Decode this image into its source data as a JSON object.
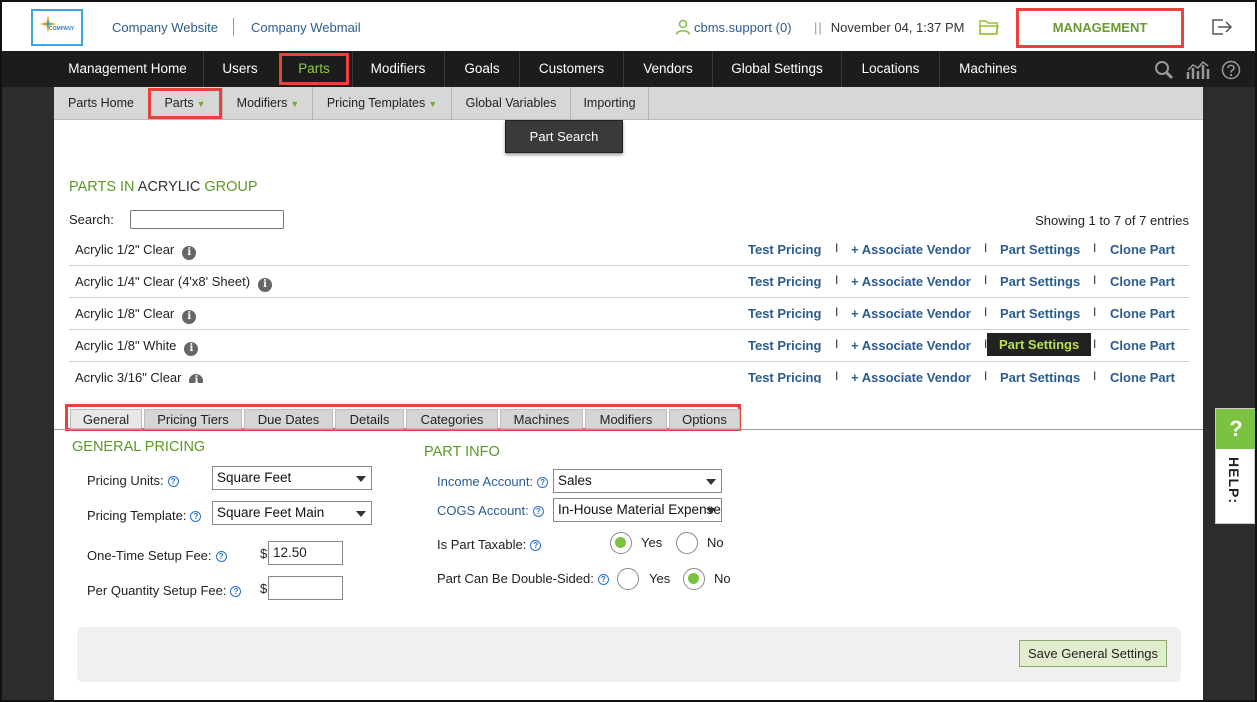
{
  "header": {
    "logo_text": "COMPANY",
    "company_website": "Company Website",
    "company_webmail": "Company Webmail",
    "user": "cbms.support (0)",
    "datetime": "November 04, 1:37 PM",
    "separator": "||",
    "management": "MANAGEMENT"
  },
  "main_nav": [
    "Management Home",
    "Users",
    "Parts",
    "Modifiers",
    "Goals",
    "Customers",
    "Vendors",
    "Global Settings",
    "Locations",
    "Machines"
  ],
  "sub_nav": {
    "parts_home": "Parts Home",
    "parts": "Parts",
    "modifiers": "Modifiers",
    "pricing_templates": "Pricing Templates",
    "global_variables": "Global Variables",
    "importing": "Importing",
    "part_search": "Part Search"
  },
  "parts": {
    "title_prefix": "PARTS IN",
    "title_group": "ACRYLIC",
    "title_suffix": "GROUP",
    "search_label": "Search:",
    "search_value": "",
    "showing": "Showing 1 to 7 of 7 entries",
    "actions": {
      "test_pricing": "Test Pricing",
      "associate_vendor": "+ Associate Vendor",
      "part_settings": "Part Settings",
      "clone_part": "Clone Part",
      "separator": "I"
    },
    "rows": [
      {
        "name": "Acrylic 1/2\" Clear"
      },
      {
        "name": "Acrylic 1/4\" Clear (4'x8' Sheet)"
      },
      {
        "name": "Acrylic 1/8\" Clear"
      },
      {
        "name": "Acrylic 1/8\" White"
      },
      {
        "name": "Acrylic 3/16\" Clear"
      }
    ]
  },
  "tabs": [
    "General",
    "Pricing Tiers",
    "Due Dates",
    "Details",
    "Categories",
    "Machines",
    "Modifiers",
    "Options"
  ],
  "general_pricing": {
    "title": "GENERAL PRICING",
    "pricing_units_label": "Pricing Units:",
    "pricing_units_value": "Square Feet",
    "pricing_template_label": "Pricing Template:",
    "pricing_template_value": "Square Feet Main",
    "one_time_setup_label": "One-Time Setup Fee:",
    "one_time_setup_value": "12.50",
    "per_qty_setup_label": "Per Quantity Setup Fee:",
    "per_qty_setup_value": "",
    "currency": "$"
  },
  "part_info": {
    "title": "PART INFO",
    "income_account_label": "Income Account:",
    "income_account_value": "Sales",
    "cogs_account_label": "COGS Account:",
    "cogs_account_value": "In-House Material Expense",
    "taxable_label": "Is Part Taxable:",
    "double_sided_label": "Part Can Be Double-Sided:",
    "yes": "Yes",
    "no": "No",
    "taxable_selected": "Yes",
    "double_sided_selected": "No"
  },
  "save_button": "Save General Settings",
  "help": {
    "icon": "?",
    "label": "HELP:"
  },
  "colors": {
    "accent_green": "#7cc242",
    "link_blue": "#2a5c8f",
    "highlight_red": "#e8423a",
    "nav_dark": "#1c1c1c"
  }
}
